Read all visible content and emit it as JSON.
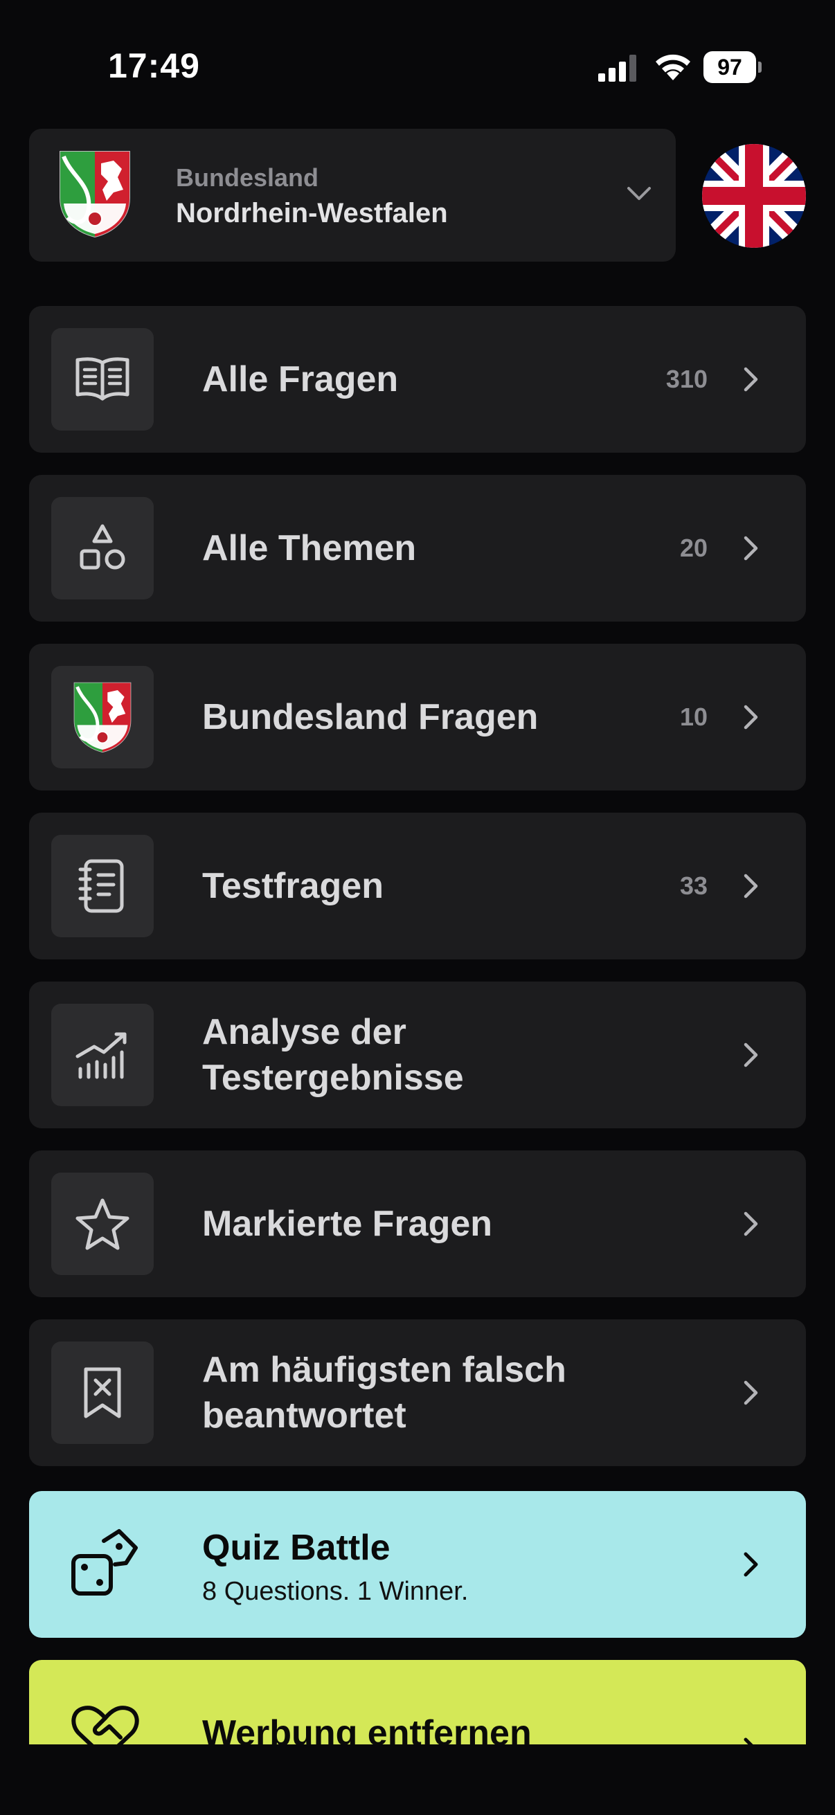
{
  "status_bar": {
    "time": "17:49",
    "battery": "97"
  },
  "state_selector": {
    "label": "Bundesland",
    "value": "Nordrhein-Westfalen",
    "crest_icon": "nrw-coat-of-arms-icon",
    "language_flag": "uk-flag-icon"
  },
  "menu": [
    {
      "title_line1": "Alle Fragen",
      "title_line2": "",
      "count": "310",
      "icon": "open-book-icon"
    },
    {
      "title_line1": "Alle Themen",
      "title_line2": "",
      "count": "20",
      "icon": "shapes-icon"
    },
    {
      "title_line1": "Bundesland Fragen",
      "title_line2": "",
      "count": "10",
      "icon": "nrw-coat-of-arms-icon"
    },
    {
      "title_line1": "Testfragen",
      "title_line2": "",
      "count": "33",
      "icon": "notebook-icon"
    },
    {
      "title_line1": "Analyse der",
      "title_line2": "Testergebnisse",
      "count": "",
      "icon": "chart-growth-icon"
    },
    {
      "title_line1": "Markierte Fragen",
      "title_line2": "",
      "count": "",
      "icon": "star-icon"
    },
    {
      "title_line1": "Am häufigsten falsch",
      "title_line2": "beantwortet",
      "count": "",
      "icon": "bookmark-x-icon"
    }
  ],
  "quiz_battle": {
    "title": "Quiz Battle",
    "subtitle": "8 Questions. 1 Winner.",
    "icon": "dice-icon",
    "color": "#a8e8ea"
  },
  "remove_ads": {
    "title": "Werbung entfernen",
    "icon": "heart-handshake-icon",
    "color": "#d4e857"
  }
}
